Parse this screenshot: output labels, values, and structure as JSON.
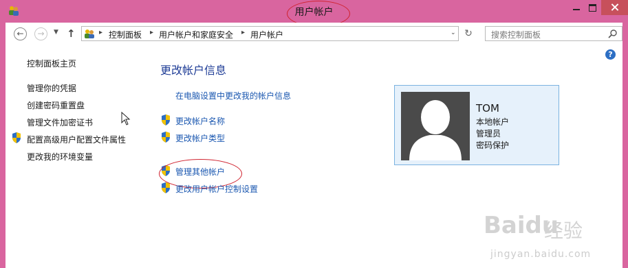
{
  "window": {
    "title": "用户帐户",
    "controls": [
      "minimize",
      "maximize",
      "close"
    ]
  },
  "address_bar": {
    "breadcrumbs": [
      "控制面板",
      "用户帐户和家庭安全",
      "用户帐户"
    ],
    "search_placeholder": "搜索控制面板"
  },
  "sidebar": {
    "home": "控制面板主页",
    "items": [
      {
        "label": "管理你的凭据",
        "shield": false
      },
      {
        "label": "创建密码重置盘",
        "shield": false
      },
      {
        "label": "管理文件加密证书",
        "shield": false
      },
      {
        "label": "配置高级用户配置文件属性",
        "shield": true
      },
      {
        "label": "更改我的环境变量",
        "shield": false
      }
    ]
  },
  "main": {
    "heading": "更改帐户信息",
    "pc_settings_link": "在电脑设置中更改我的帐户信息",
    "links": [
      {
        "label": "更改帐户名称",
        "shield": true
      },
      {
        "label": "更改帐户类型",
        "shield": true
      },
      {
        "label": "管理其他帐户",
        "shield": true
      },
      {
        "label": "更改用户帐户控制设置",
        "shield": true
      }
    ]
  },
  "user_card": {
    "name": "TOM",
    "account_type": "本地帐户",
    "role": "管理员",
    "password_status": "密码保护"
  },
  "annotations": {
    "highlight_color": "#d0232f"
  },
  "watermark": {
    "logo": "Bai",
    "logo_tail": "du",
    "text": "经验",
    "url": "jingyan.baidu.com"
  },
  "colors": {
    "window_frame": "#d9659f",
    "link": "#1a57b0",
    "heading": "#1e3c96",
    "card_bg": "#e6f1fb",
    "card_border": "#7ab2e0"
  }
}
